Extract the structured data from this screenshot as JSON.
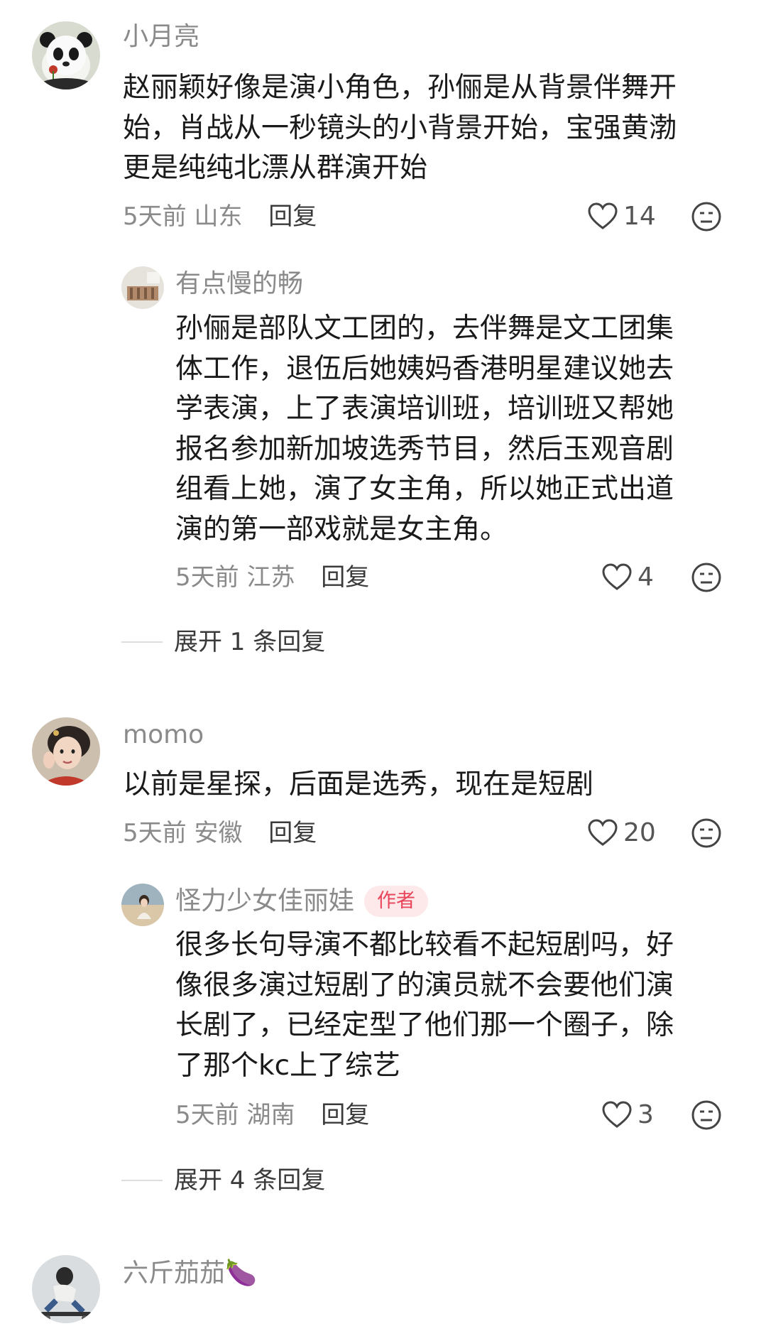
{
  "comments": [
    {
      "user": "小月亮",
      "avatar": "panda-avatar",
      "lines": [
        "赵丽颖好像是演小角色，孙俪是从背景伴舞开",
        "始，肖战从一秒镜头的小背景开始，宝强黄渤",
        "更是纯纯北漂从群演开始"
      ],
      "time": "5天前",
      "location": "山东",
      "reply_label": "回复",
      "likes": "14",
      "replies": [
        {
          "user": "有点慢的畅",
          "avatar": "room-avatar",
          "lines": [
            "孙俪是部队文工团的，去伴舞是文工团集",
            "体工作，退伍后她姨妈香港明星建议她去",
            "学表演，上了表演培训班，培训班又帮她",
            "报名参加新加坡选秀节目，然后玉观音剧",
            "组看上她，演了女主角，所以她正式出道",
            "演的第一部戏就是女主角。"
          ],
          "time": "5天前",
          "location": "江苏",
          "reply_label": "回复",
          "likes": "4"
        }
      ],
      "expand_label": "展开 1 条回复"
    },
    {
      "user": "momo",
      "avatar": "girl-avatar",
      "lines": [
        "以前是星探，后面是选秀，现在是短剧"
      ],
      "time": "5天前",
      "location": "安徽",
      "reply_label": "回复",
      "likes": "20",
      "replies": [
        {
          "user": "怪力少女佳丽娃",
          "badge": "作者",
          "avatar": "beach-avatar",
          "lines": [
            "很多长句导演不都比较看不起短剧吗，好",
            "像很多演过短剧了的演员就不会要他们演",
            "长剧了，已经定型了他们那一个圈子，除",
            "了那个kc上了综艺"
          ],
          "time": "5天前",
          "location": "湖南",
          "reply_label": "回复",
          "likes": "3"
        }
      ],
      "expand_label": "展开 4 条回复"
    },
    {
      "user": "六斤茄茄🍆",
      "avatar": "skater-avatar",
      "lines": []
    }
  ],
  "colors": {
    "name": "#8a8a8a",
    "text": "#1a1a1a",
    "author_badge_bg": "#fde8ea",
    "author_badge_fg": "#e8455a"
  }
}
